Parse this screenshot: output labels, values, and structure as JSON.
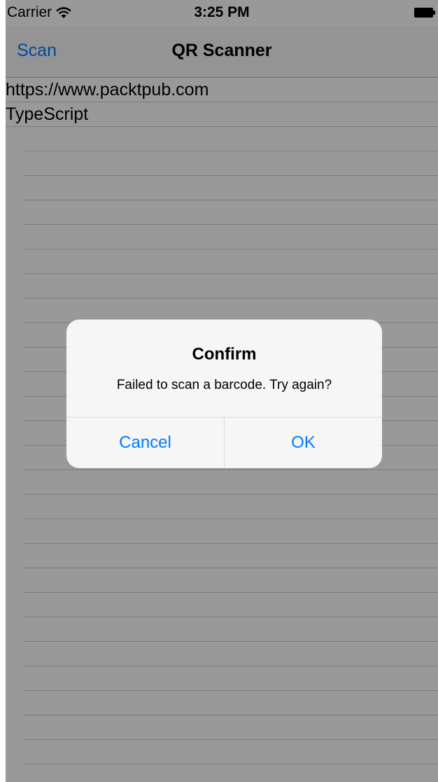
{
  "status_bar": {
    "carrier": "Carrier",
    "time": "3:25 PM"
  },
  "nav": {
    "left_button": "Scan",
    "title": "QR Scanner"
  },
  "list": {
    "items": [
      "https://www.packtpub.com",
      "TypeScript"
    ]
  },
  "dialog": {
    "title": "Confirm",
    "message": "Failed to scan a barcode. Try again?",
    "cancel_label": "Cancel",
    "ok_label": "OK"
  },
  "colors": {
    "accent": "#007aff",
    "overlay": "rgba(0,0,0,0.40)"
  }
}
